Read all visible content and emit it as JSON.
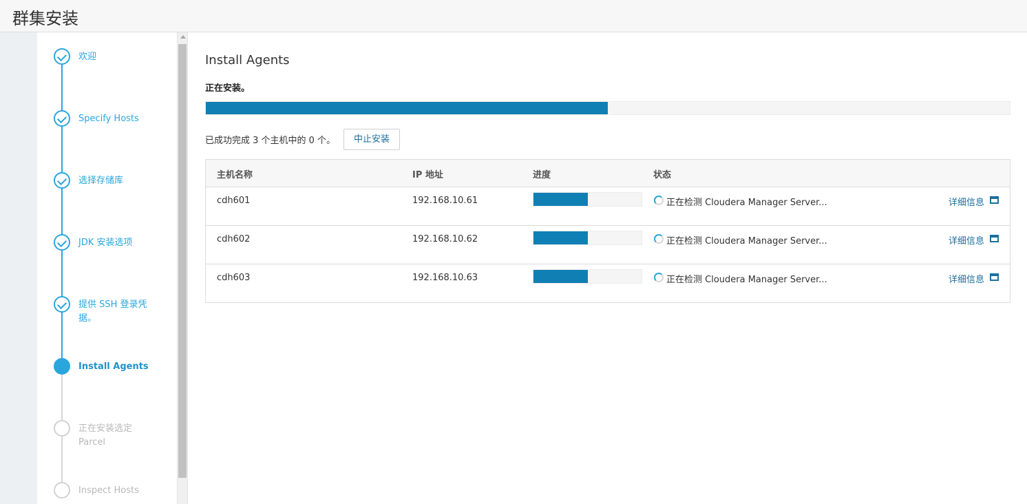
{
  "app": {
    "title": "群集安装"
  },
  "wizard": {
    "steps": [
      {
        "label": "欢迎",
        "state": "done"
      },
      {
        "label": "Specify Hosts",
        "state": "done"
      },
      {
        "label": "选择存储库",
        "state": "done"
      },
      {
        "label": "JDK 安装选项",
        "state": "done"
      },
      {
        "label": "提供 SSH 登录凭据。",
        "state": "done"
      },
      {
        "label": "Install Agents",
        "state": "active"
      },
      {
        "label": "正在安装选定 Parcel",
        "state": "pending"
      },
      {
        "label": "Inspect Hosts",
        "state": "pending"
      }
    ]
  },
  "main": {
    "heading": "Install Agents",
    "status_title": "正在安装。",
    "overall_progress": 0.5,
    "summary": "已成功完成 3 个主机中的 0 个。",
    "abort_label": "中止安装",
    "table": {
      "headers": {
        "hostname": "主机名称",
        "ip": "IP 地址",
        "progress": "进度",
        "status": "状态"
      },
      "rows": [
        {
          "hostname": "cdh601",
          "ip": "192.168.10.61",
          "progress": 0.5,
          "status": "正在检测 Cloudera Manager Server...",
          "details": "详细信息"
        },
        {
          "hostname": "cdh602",
          "ip": "192.168.10.62",
          "progress": 0.5,
          "status": "正在检测 Cloudera Manager Server...",
          "details": "详细信息"
        },
        {
          "hostname": "cdh603",
          "ip": "192.168.10.63",
          "progress": 0.5,
          "status": "正在检测 Cloudera Manager Server...",
          "details": "详细信息"
        }
      ]
    }
  },
  "colors": {
    "accent": "#2aa6dd",
    "progress_fill": "#0f7fb4",
    "link": "#1a6f9c"
  },
  "icons": {
    "step_done": "check-circle-icon",
    "status": "spinner-icon",
    "details": "window-icon"
  }
}
